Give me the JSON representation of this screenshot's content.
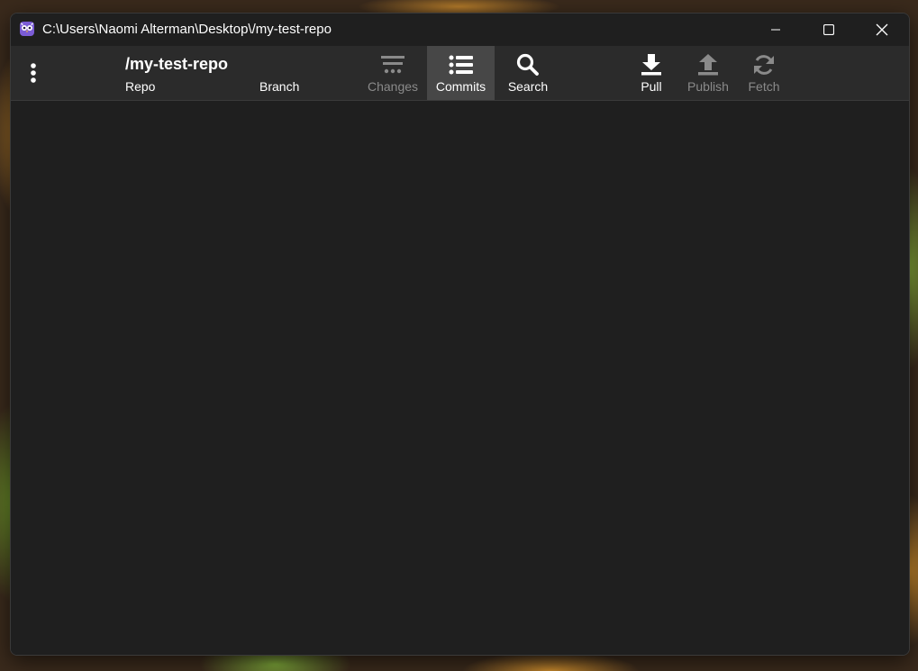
{
  "window": {
    "title": "C:\\Users\\Naomi Alterman\\Desktop\\/my-test-repo",
    "app_icon": "owl-icon",
    "controls": {
      "minimize_icon": "minimize-icon",
      "maximize_icon": "maximize-icon",
      "close_icon": "close-icon"
    }
  },
  "toolbar": {
    "menu_icon": "kebab-menu-icon",
    "repo_name": "/my-test-repo",
    "repo_label": "Repo",
    "branch_label": "Branch",
    "buttons": [
      {
        "label": "Changes",
        "icon": "changes-icon",
        "state": "disabled"
      },
      {
        "label": "Commits",
        "icon": "list-icon",
        "state": "active"
      },
      {
        "label": "Search",
        "icon": "search-icon",
        "state": "enabled"
      },
      {
        "label": "Pull",
        "icon": "download-icon",
        "state": "enabled"
      },
      {
        "label": "Publish",
        "icon": "upload-icon",
        "state": "disabled"
      },
      {
        "label": "Fetch",
        "icon": "refresh-icon",
        "state": "disabled"
      }
    ]
  },
  "colors": {
    "window_bg": "#1f1f1f",
    "toolbar_bg": "#2b2b2b",
    "active_button_bg": "#474747",
    "text": "#ffffff",
    "disabled_text": "#8a8a8a"
  }
}
